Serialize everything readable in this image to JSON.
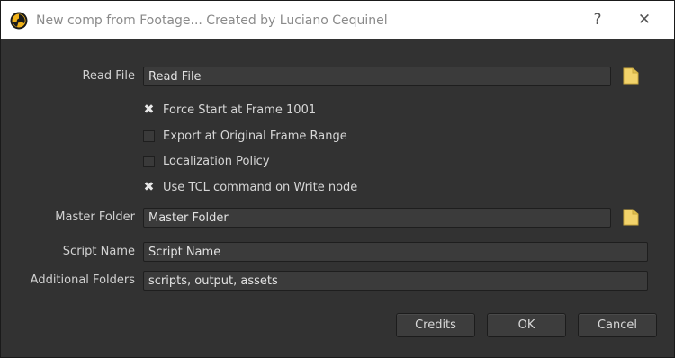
{
  "titlebar": {
    "title": "New comp from Footage... Created by Luciano Cequinel",
    "app_icon": "nuke-icon",
    "help_glyph": "?",
    "close_glyph": "✕"
  },
  "read_file": {
    "label": "Read File",
    "value": "Read File"
  },
  "options": [
    {
      "label": "Force Start at Frame 1001",
      "checked": true
    },
    {
      "label": "Export at Original Frame Range",
      "checked": false
    },
    {
      "label": "Localization Policy",
      "checked": false
    },
    {
      "label": "Use TCL command on Write node",
      "checked": true
    }
  ],
  "master_folder": {
    "label": "Master Folder",
    "value": "Master Folder"
  },
  "script_name": {
    "label": "Script Name",
    "value": "Script Name"
  },
  "additional_folders": {
    "label": "Additional Folders",
    "value": "scripts, output, assets"
  },
  "buttons": {
    "credits": "Credits",
    "ok": "OK",
    "cancel": "Cancel"
  },
  "icons": {
    "folder": "folder-icon",
    "check": "✖"
  },
  "colors": {
    "folder_icon": "#f2d36b",
    "background": "#323232",
    "titlebar": "#ffffff"
  }
}
